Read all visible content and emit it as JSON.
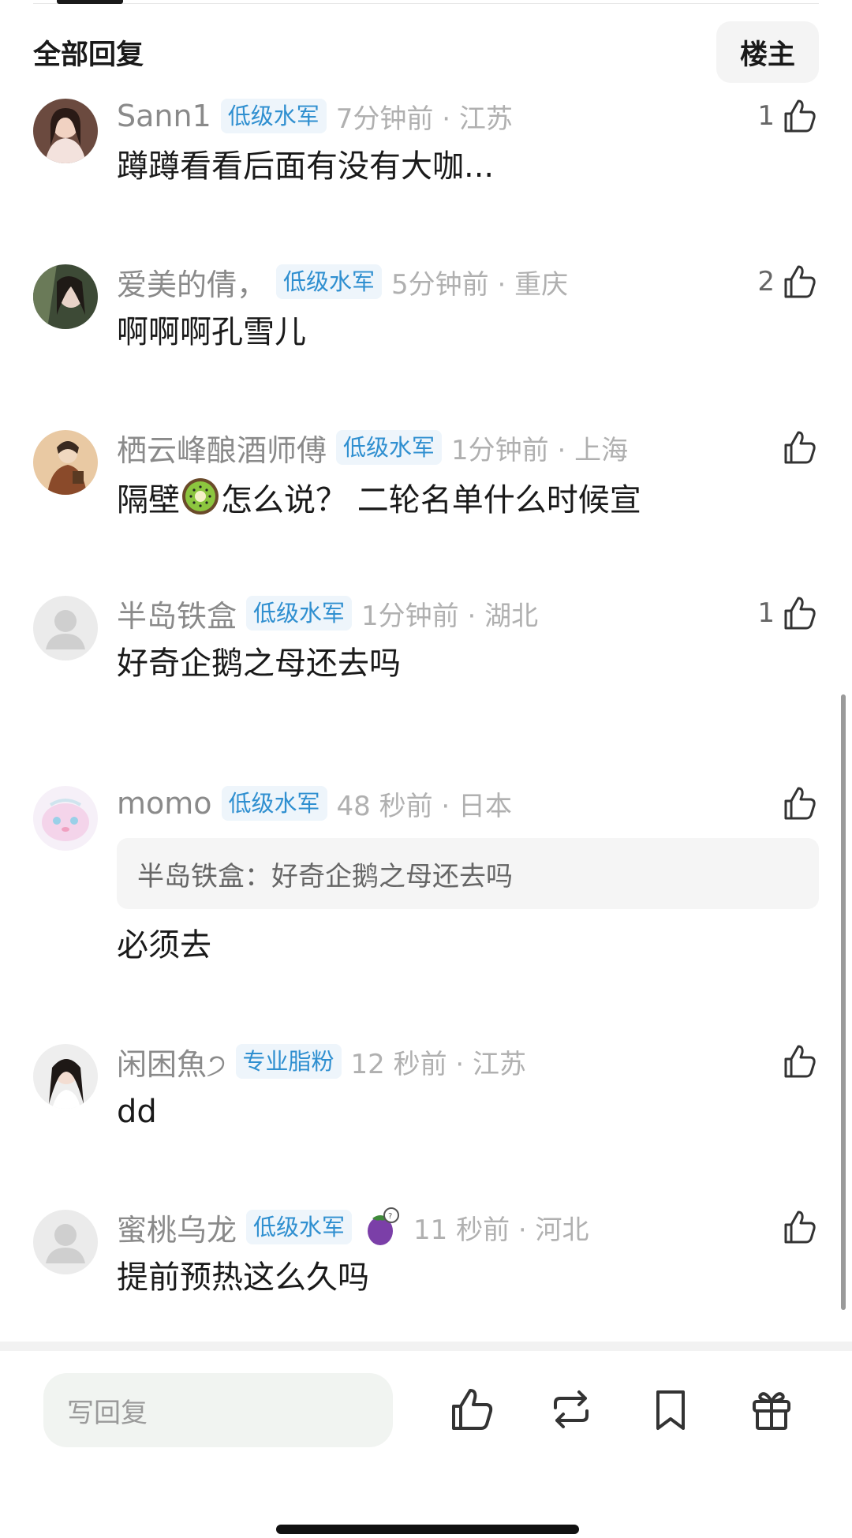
{
  "header": {
    "title": "全部回复",
    "op_button": "楼主"
  },
  "comments": [
    {
      "username": "Sann1",
      "badge": "低级水军",
      "time": "7分钟前 · 江苏",
      "likes": "1",
      "content": "蹲蹲看看后面有没有大咖..."
    },
    {
      "username": "爱美的倩，",
      "badge": "低级水军",
      "time": "5分钟前 · 重庆",
      "likes": "2",
      "content": "啊啊啊孔雪儿"
    },
    {
      "username": "栖云峰酿酒师傅",
      "badge": "低级水军",
      "time": "1分钟前 · 上海",
      "likes": "",
      "content_before": "隔壁",
      "content_emoji": "kiwi-emoji",
      "content_after": "怎么说？ 二轮名单什么时候宣"
    },
    {
      "username": "半岛铁盒",
      "badge": "低级水军",
      "time": "1分钟前 · 湖北",
      "likes": "1",
      "content": "好奇企鹅之母还去吗"
    },
    {
      "username": "momo",
      "badge": "低级水军",
      "time": "48 秒前 · 日本",
      "likes": "",
      "quote": "半岛铁盒：好奇企鹅之母还去吗",
      "content": "必须去"
    },
    {
      "username": "闲困魚੭",
      "badge": "专业脂粉",
      "time": "12 秒前 · 江苏",
      "likes": "",
      "content": "dd"
    },
    {
      "username": "蜜桃乌龙",
      "badge": "低级水军",
      "time": "11 秒前 · 河北",
      "likes": "",
      "content": "提前预热这么久吗"
    }
  ],
  "bottom_bar": {
    "reply_placeholder": "写回复",
    "icons": [
      "thumbs-up-icon",
      "repost-icon",
      "bookmark-icon",
      "gift-icon"
    ]
  },
  "colors": {
    "badge_text": "#2f8fd0",
    "badge_bg": "#eef5fb",
    "meta_text": "#8a8a8a",
    "time_text": "#b0b0b0"
  }
}
